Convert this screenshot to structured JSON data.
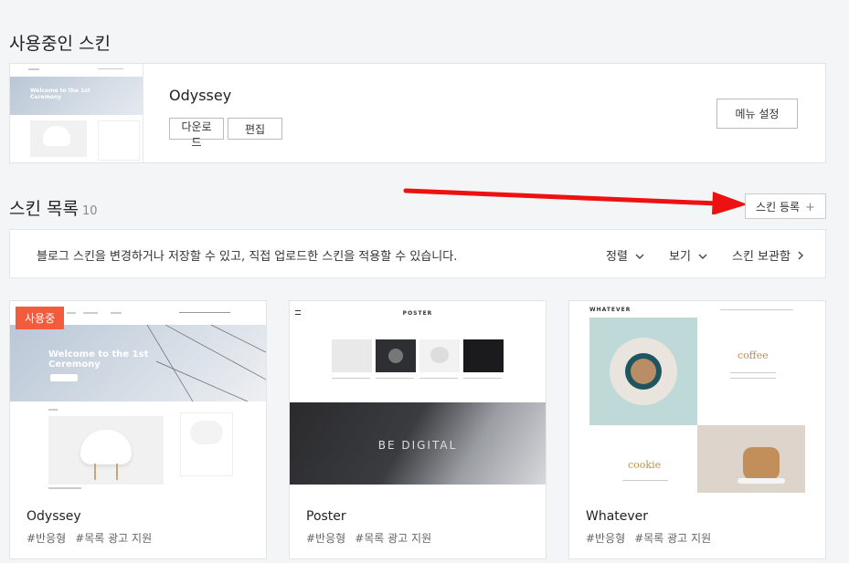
{
  "current_section": {
    "title": "사용중인 스킨",
    "skin_name": "Odyssey",
    "download_label": "다운로드",
    "edit_label": "편집",
    "menu_settings_label": "메뉴 설정"
  },
  "list_section": {
    "title": "스킨 목록",
    "count": "10",
    "register_label": "스킨 등록",
    "register_plus": "+"
  },
  "info_bar": {
    "text": "블로그 스킨을 변경하거나 저장할 수 있고, 직접 업로드한 스킨을 적용할 수 있습니다.",
    "sort_label": "정렬",
    "view_label": "보기",
    "storage_label": "스킨 보관함"
  },
  "cards": [
    {
      "name": "Odyssey",
      "tags": [
        "#반응형",
        "#목록 광고 지원"
      ],
      "badge": "사용중",
      "thumb_title_1": "Welcome to the 1st",
      "thumb_title_2": "Ceremony"
    },
    {
      "name": "Poster",
      "tags": [
        "#반응형",
        "#목록 광고 지원"
      ],
      "thumb_logo": "POSTER",
      "thumb_banner": "BE DIGITAL"
    },
    {
      "name": "Whatever",
      "tags": [
        "#반응형",
        "#목록 광고 지원"
      ],
      "thumb_logo": "WHATEVER",
      "thumb_word_1": "coffee",
      "thumb_word_2": "cookie"
    }
  ],
  "colors": {
    "background": "#f4f5f7",
    "badge": "#f25c3d",
    "annotation_arrow": "#ee1111"
  },
  "icons": {
    "chevron": "chevron-down-icon",
    "chevron_right": "chevron-right-icon",
    "plus": "plus-icon"
  }
}
